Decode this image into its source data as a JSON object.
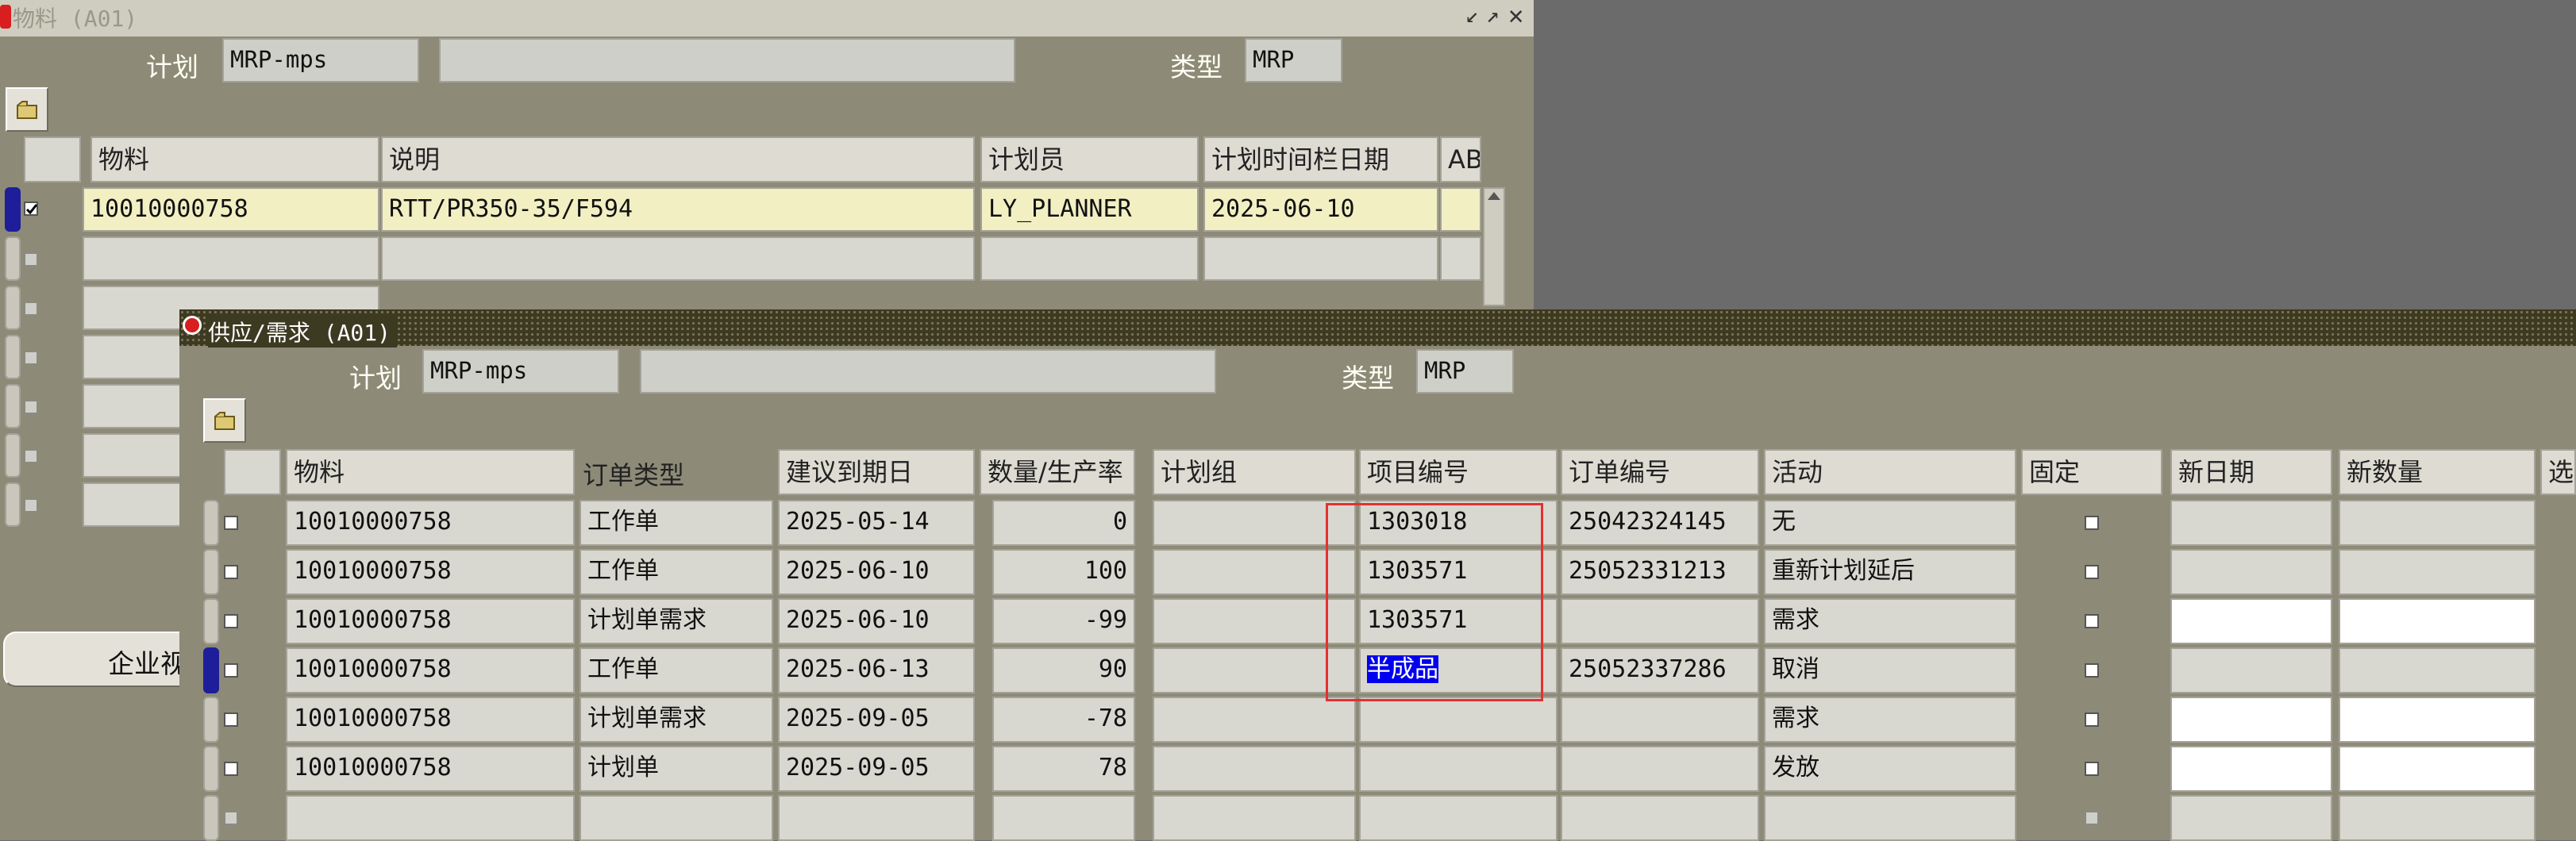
{
  "w1": {
    "title": "物料 (A01)",
    "plan_label": "计划",
    "plan_value": "MRP-mps",
    "plan_desc": "",
    "type_label": "类型",
    "type_value": "MRP",
    "headers": [
      "物料",
      "说明",
      "计划员",
      "计划时间栏日期",
      "ABC"
    ],
    "row1": {
      "item": "10010000758",
      "desc": "RTT/PR350-35/F594",
      "planner": "LY_PLANNER",
      "date": "2025-06-10",
      "abc": ""
    },
    "bottom_button": "企业视"
  },
  "w2": {
    "title": "供应/需求 (A01)",
    "plan_label": "计划",
    "plan_value": "MRP-mps",
    "plan_desc": "",
    "type_label": "类型",
    "type_value": "MRP",
    "headers": [
      "物料",
      "订单类型",
      "建议到期日",
      "数量/生产率",
      "计划组",
      "项目编号",
      "订单编号",
      "活动",
      "固定",
      "新日期",
      "新数量",
      "选"
    ],
    "rows": [
      {
        "item": "10010000758",
        "order_type": "工作单",
        "due": "2025-05-14",
        "qty": "0",
        "group": "",
        "project": "1303018",
        "order_no": "25042324145",
        "action": "无"
      },
      {
        "item": "10010000758",
        "order_type": "工作单",
        "due": "2025-06-10",
        "qty": "100",
        "group": "",
        "project": "1303571",
        "order_no": "25052331213",
        "action": "重新计划延后"
      },
      {
        "item": "10010000758",
        "order_type": "计划单需求",
        "due": "2025-06-10",
        "qty": "-99",
        "group": "",
        "project": "1303571",
        "order_no": "",
        "action": "需求"
      },
      {
        "item": "10010000758",
        "order_type": "工作单",
        "due": "2025-06-13",
        "qty": "90",
        "group": "",
        "project": "半成品",
        "order_no": "25052337286",
        "action": "取消"
      },
      {
        "item": "10010000758",
        "order_type": "计划单需求",
        "due": "2025-09-05",
        "qty": "-78",
        "group": "",
        "project": "",
        "order_no": "",
        "action": "需求"
      },
      {
        "item": "10010000758",
        "order_type": "计划单",
        "due": "2025-09-05",
        "qty": "78",
        "group": "",
        "project": "",
        "order_no": "",
        "action": "发放"
      }
    ]
  },
  "colors": {
    "window_bg": "#8d8b78",
    "cell_bg": "#d9d8d0",
    "current_row": "#f2efc3",
    "highlight": "#0000ee",
    "red_box": "#e53030"
  }
}
